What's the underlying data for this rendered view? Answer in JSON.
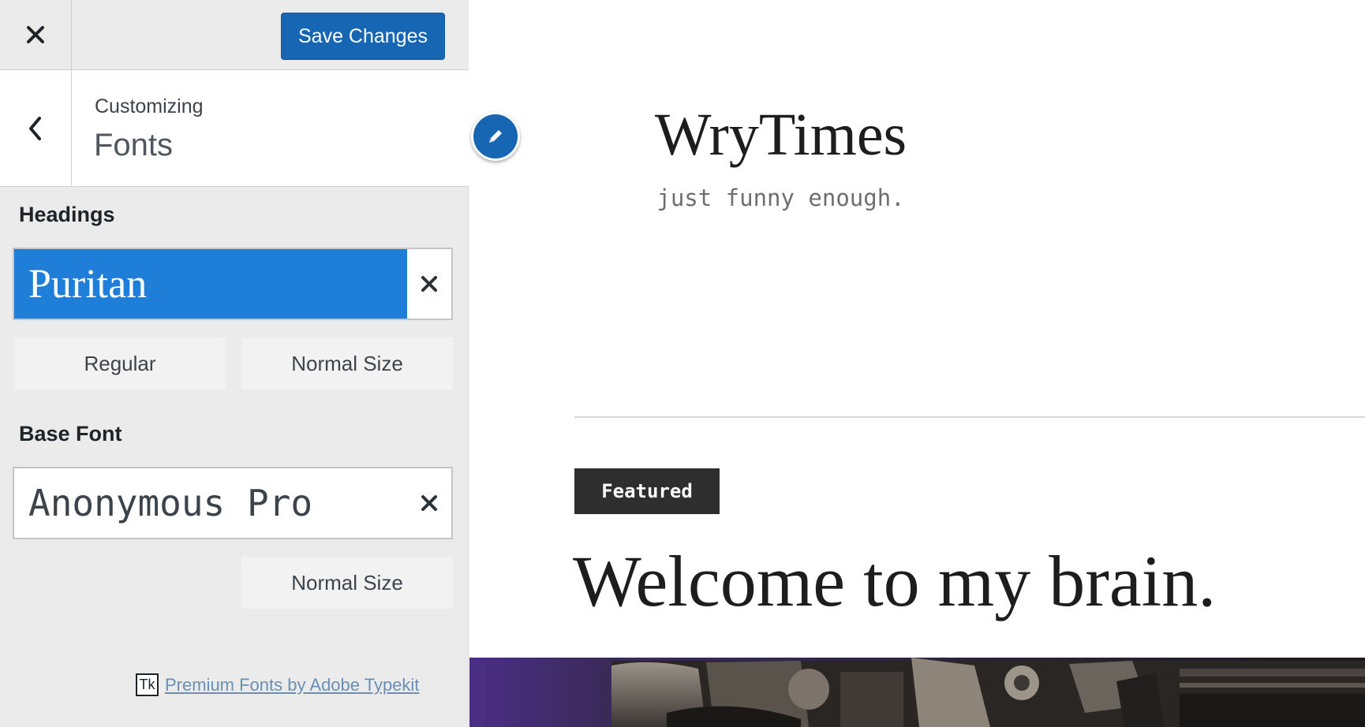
{
  "topbar": {
    "close_icon": "close-icon",
    "save_label": "Save Changes",
    "save_color": "#1766b4"
  },
  "section": {
    "back_icon": "chevron-left-icon",
    "breadcrumb": "Customizing",
    "title": "Fonts"
  },
  "headings": {
    "label": "Headings",
    "font_name": "Puritan",
    "selected_color": "#1f7fd8",
    "clear_icon": "close-icon",
    "weight_label": "Regular",
    "size_label": "Normal Size"
  },
  "base_font": {
    "label": "Base Font",
    "font_name": "Anonymous Pro",
    "clear_icon": "close-icon",
    "size_label": "Normal Size"
  },
  "footer": {
    "logo_text": "Tk",
    "link_text": "Premium Fonts by Adobe Typekit"
  },
  "edit_shortcut": {
    "icon": "pencil-icon"
  },
  "preview": {
    "site_title": "WryTimes",
    "tagline": "just funny enough.",
    "badge": "Featured",
    "post_title": "Welcome to my brain.",
    "badge_color": "#2e2e2e"
  }
}
